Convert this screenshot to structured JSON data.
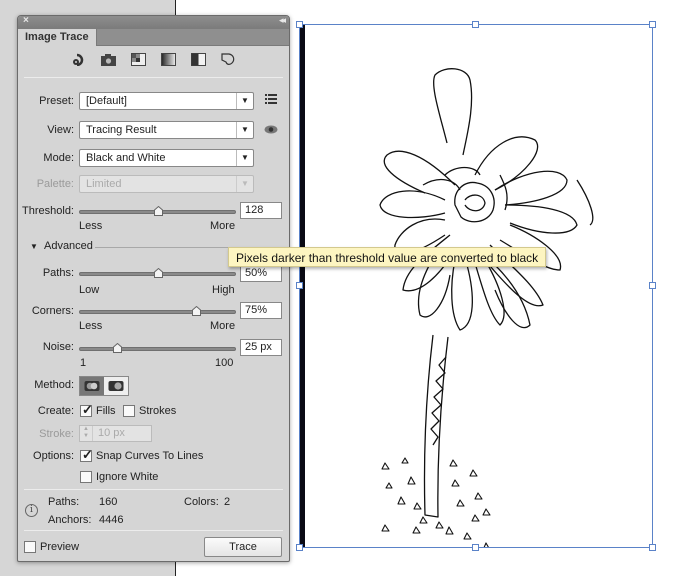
{
  "panel": {
    "close_glyph": "×",
    "collapse_glyph": "◂◂",
    "tab_title": "Image Trace",
    "preset_icons": [
      "auto-color-icon",
      "high-color-icon",
      "low-color-icon",
      "grayscale-icon",
      "black-white-icon",
      "outline-icon"
    ],
    "preset": {
      "label": "Preset:",
      "value": "[Default]"
    },
    "view": {
      "label": "View:",
      "value": "Tracing Result"
    },
    "mode": {
      "label": "Mode:",
      "value": "Black and White"
    },
    "palette": {
      "label": "Palette:",
      "value": "Limited",
      "disabled": true
    },
    "threshold": {
      "label": "Threshold:",
      "value": "128",
      "fraction": 0.5,
      "min_label": "Less",
      "max_label": "More"
    },
    "advanced": {
      "label": "Advanced",
      "expanded": true
    },
    "paths": {
      "label": "Paths:",
      "value": "50%",
      "fraction": 0.5,
      "min_label": "Low",
      "max_label": "High"
    },
    "corners": {
      "label": "Corners:",
      "value": "75%",
      "fraction": 0.75,
      "min_label": "Less",
      "max_label": "More"
    },
    "noise": {
      "label": "Noise:",
      "value": "25 px",
      "fraction": 0.24,
      "min_label": "1",
      "max_label": "100"
    },
    "method": {
      "label": "Method:",
      "options": [
        "abutting",
        "overlapping"
      ],
      "selected": "abutting"
    },
    "create": {
      "label": "Create:",
      "fills": {
        "label": "Fills",
        "checked": true
      },
      "strokes": {
        "label": "Strokes",
        "checked": false
      }
    },
    "stroke": {
      "label": "Stroke:",
      "value": "10 px",
      "disabled": true
    },
    "options": {
      "label": "Options:",
      "snap": {
        "label": "Snap Curves To Lines",
        "checked": true
      },
      "ignore_white": {
        "label": "Ignore White",
        "checked": false
      }
    },
    "info": {
      "paths_label": "Paths:",
      "paths_value": "160",
      "anchors_label": "Anchors:",
      "anchors_value": "4446",
      "colors_label": "Colors:",
      "colors_value": "2"
    },
    "preview": {
      "label": "Preview",
      "checked": false
    },
    "trace_button": "Trace"
  },
  "tooltip": "Pixels darker than threshold value are converted to black",
  "colors": {
    "selection": "#5a82c8",
    "tooltip_bg": "#fdf5c1",
    "panel_bg": "#d5d5d5"
  }
}
